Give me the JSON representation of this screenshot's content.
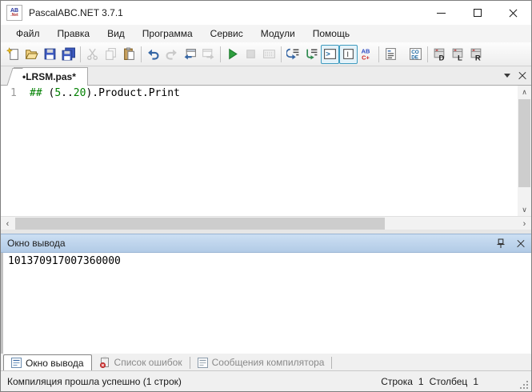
{
  "window": {
    "title": "PascalABC.NET 3.7.1",
    "app_icon_text": {
      "top": "AB",
      "bottom": ".Net"
    }
  },
  "menu": {
    "items": [
      "Файл",
      "Правка",
      "Вид",
      "Программа",
      "Сервис",
      "Модули",
      "Помощь"
    ]
  },
  "toolbar": {
    "buttons": [
      "new-file",
      "open-file",
      "save-file",
      "save-all",
      "cut",
      "copy",
      "paste",
      "undo",
      "redo",
      "navigate-back-window",
      "navigate-forward-window",
      "run",
      "stop",
      "keyboard-grid",
      "arrow-to-lines-1",
      "arrow-to-lines-2",
      "console-output-toggle",
      "input-cursor-toggle",
      "abc-snippet",
      "checklist",
      "code-view",
      "pad-d",
      "pad-l",
      "pad-r"
    ],
    "icon_text": {
      "console_glyph": ">",
      "ibeam_glyph": "I",
      "abc_top": "AB",
      "abc_bottom": "C+",
      "code_top": "CO",
      "code_bottom": "DE",
      "pad_d": "D",
      "pad_l": "L",
      "pad_r": "R"
    }
  },
  "tabstrip": {
    "active_tab": "•LRSM.pas*"
  },
  "editor": {
    "line_number": "1",
    "code": {
      "s0": "##",
      "s1": " (",
      "s2": "5",
      "s3": "..",
      "s4": "20",
      "s5": ")",
      "s6": ".Product.Print"
    }
  },
  "output_panel": {
    "title": "Окно вывода",
    "content": "101370917007360000"
  },
  "bottom_tabs": {
    "t0": "Окно вывода",
    "t1": "Список ошибок",
    "t2": "Сообщения компилятора"
  },
  "status_bar": {
    "message": "Компиляция прошла успешно (1 строк)",
    "line_label": "Строка",
    "line_value": "1",
    "column_label": "Столбец",
    "column_value": "1"
  },
  "colors": {
    "directive_green": "#008000",
    "number_green": "#008000",
    "accent_blue": "#3465a4",
    "run_green": "#2e9e3e",
    "error_red": "#cc2222",
    "output_header_bg": "#bed3eb"
  }
}
